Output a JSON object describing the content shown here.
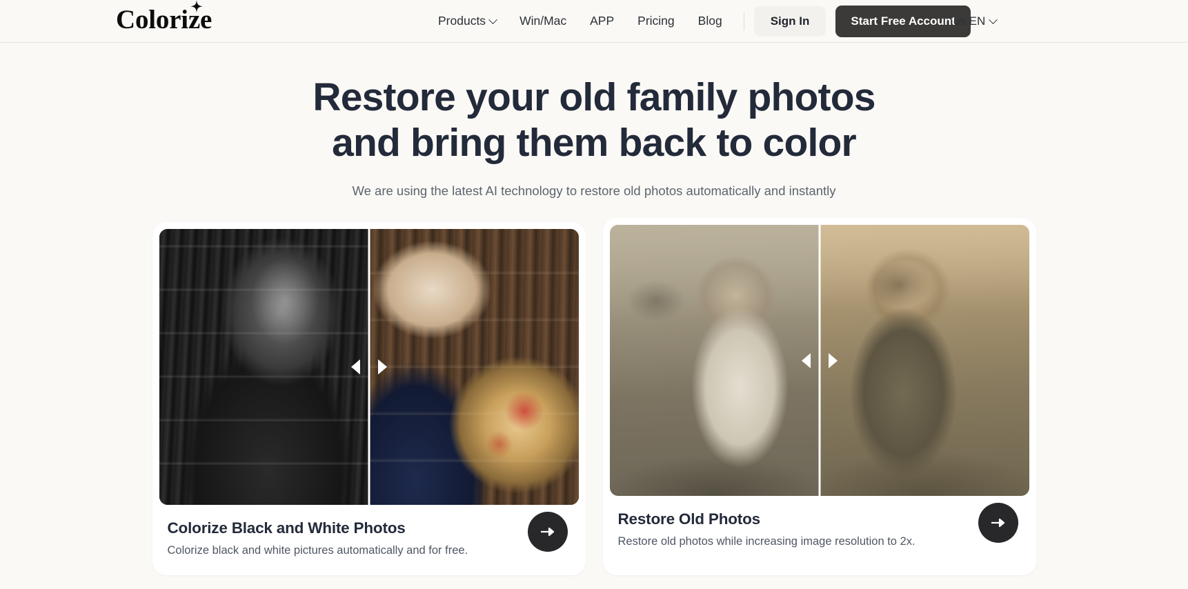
{
  "brand": {
    "name": "Colorize",
    "star_icon": "sparkle-icon"
  },
  "header": {
    "nav": [
      {
        "label": "Products",
        "has_chevron": true
      },
      {
        "label": "Win/Mac",
        "has_chevron": false
      },
      {
        "label": "APP",
        "has_chevron": false
      },
      {
        "label": "Pricing",
        "has_chevron": false
      },
      {
        "label": "Blog",
        "has_chevron": false
      }
    ],
    "sign_in_label": "Sign In",
    "start_free_label": "Start Free Account",
    "language": "us EN",
    "accent_dark": "#3b3a38",
    "signin_bg": "#f2f1ee"
  },
  "hero": {
    "title_line1": "Restore your old family photos",
    "title_line2": "and bring them back to color",
    "subtitle": "We are using the latest AI technology to restore old photos automatically and instantly",
    "title_color": "#232a3a",
    "subtitle_color": "#5d6470"
  },
  "cards": [
    {
      "title": "Colorize Black and White Photos",
      "description": "Colorize black and white pictures automatically and for free.",
      "cta_icon": "arrow-right-icon",
      "slider_icon_left": "triangle-left-icon",
      "slider_icon_right": "triangle-right-icon",
      "before_alt": "Einstein portrait in black and white",
      "after_alt": "Einstein portrait colorized with globe"
    },
    {
      "title": "Restore Old Photos",
      "description": "Restore old photos while increasing image resolution to 2x.",
      "cta_icon": "arrow-right-icon",
      "slider_icon_left": "triangle-left-icon",
      "slider_icon_right": "triangle-right-icon",
      "before_alt": "Two girls old faded photo",
      "after_alt": "Two girls restored sepia photo"
    }
  ],
  "theme": {
    "page_bg": "#faf9f5",
    "card_bg": "#ffffff",
    "cta_bg": "#28282a"
  }
}
